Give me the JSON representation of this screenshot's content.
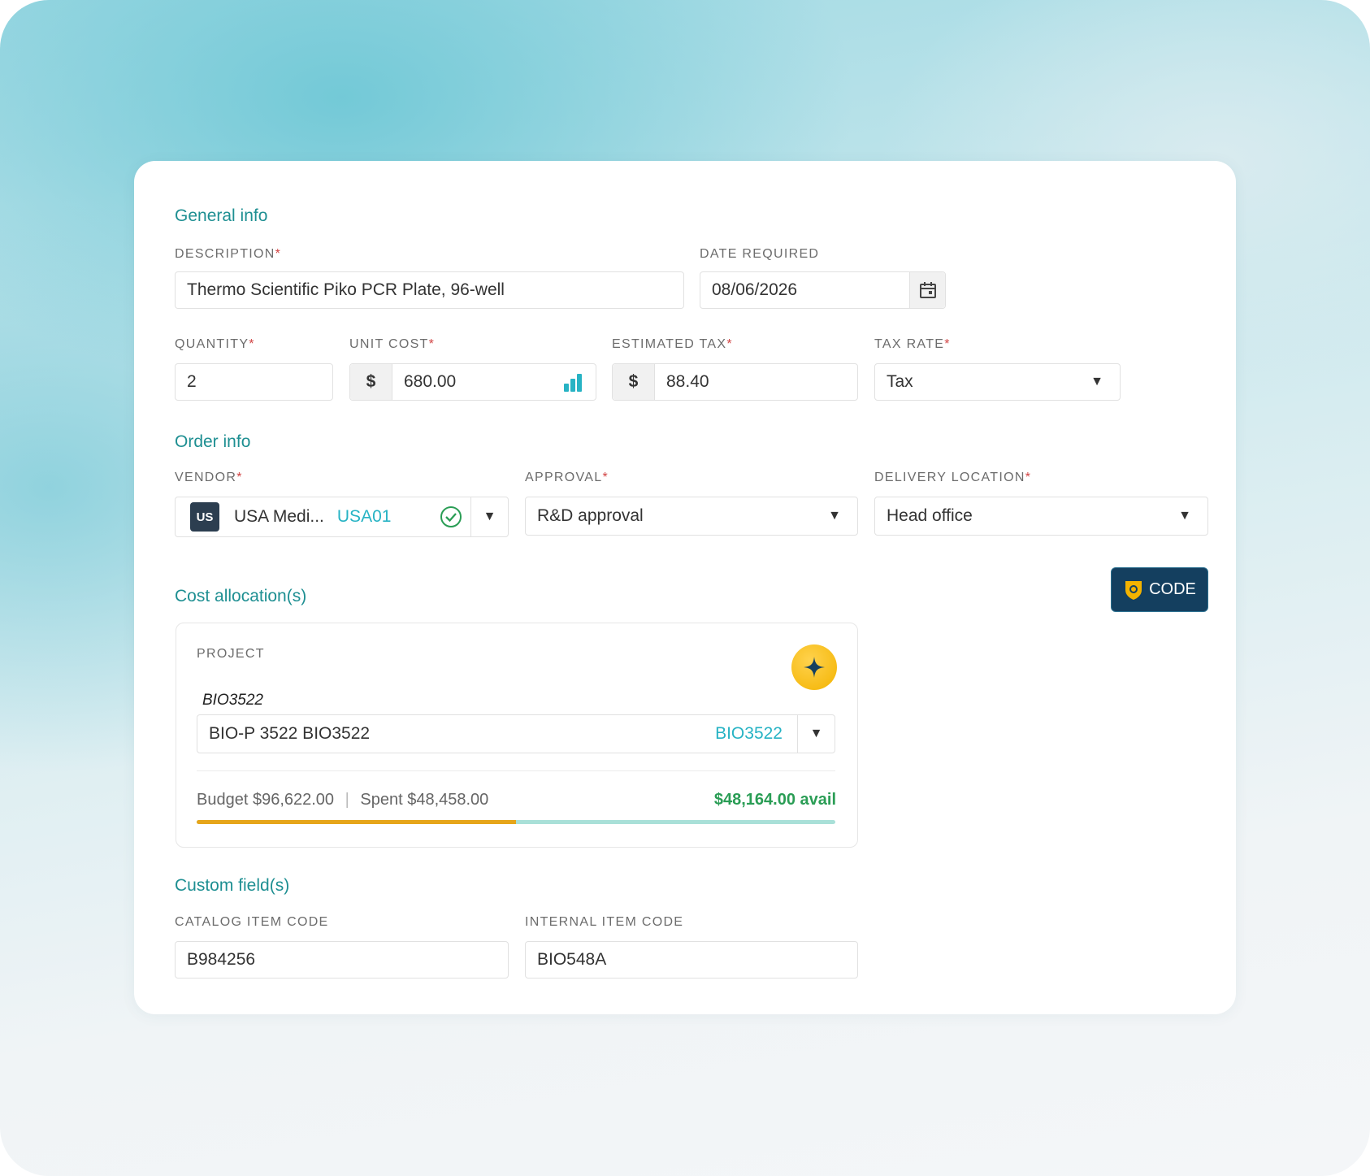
{
  "general": {
    "title": "General info",
    "description_label": "DESCRIPTION",
    "description_value": "Thermo Scientific Piko PCR Plate, 96-well",
    "date_label": "DATE REQUIRED",
    "date_value": "08/06/2026",
    "quantity_label": "QUANTITY",
    "quantity_value": "2",
    "unit_cost_label": "UNIT COST",
    "unit_cost_prefix": "$",
    "unit_cost_value": "680.00",
    "tax_label": "ESTIMATED TAX",
    "tax_prefix": "$",
    "tax_value": "88.40",
    "tax_rate_label": "TAX RATE",
    "tax_rate_value": "Tax",
    "required_mark": "*"
  },
  "order": {
    "title": "Order info",
    "vendor_label": "VENDOR",
    "vendor_flag": "US",
    "vendor_name": "USA Medi...",
    "vendor_code": "USA01",
    "approval_label": "APPROVAL",
    "approval_value": "R&D approval",
    "delivery_label": "DELIVERY LOCATION",
    "delivery_value": "Head office"
  },
  "cost": {
    "title": "Cost allocation(s)",
    "code_button": "CODE",
    "project_label": "PROJECT",
    "project_heading": "BIO3522",
    "project_value": "BIO-P 3522 BIO3522",
    "project_code": "BIO3522",
    "budget_text": "Budget $96,622.00",
    "separator": "|",
    "spent_text": "Spent $48,458.00",
    "avail_text": "$48,164.00 avail",
    "spent_fraction": 0.5
  },
  "custom": {
    "title": "Custom field(s)",
    "catalog_label": "CATALOG ITEM CODE",
    "catalog_value": "B984256",
    "internal_label": "INTERNAL ITEM CODE",
    "internal_value": "BIO548A"
  },
  "colors": {
    "accent": "#1e8f92",
    "link": "#27b3c4",
    "avail": "#2a9d55",
    "code_button": "#143f5f",
    "progress_spent": "#e6a51a",
    "progress_remaining": "#a9e0d8"
  }
}
